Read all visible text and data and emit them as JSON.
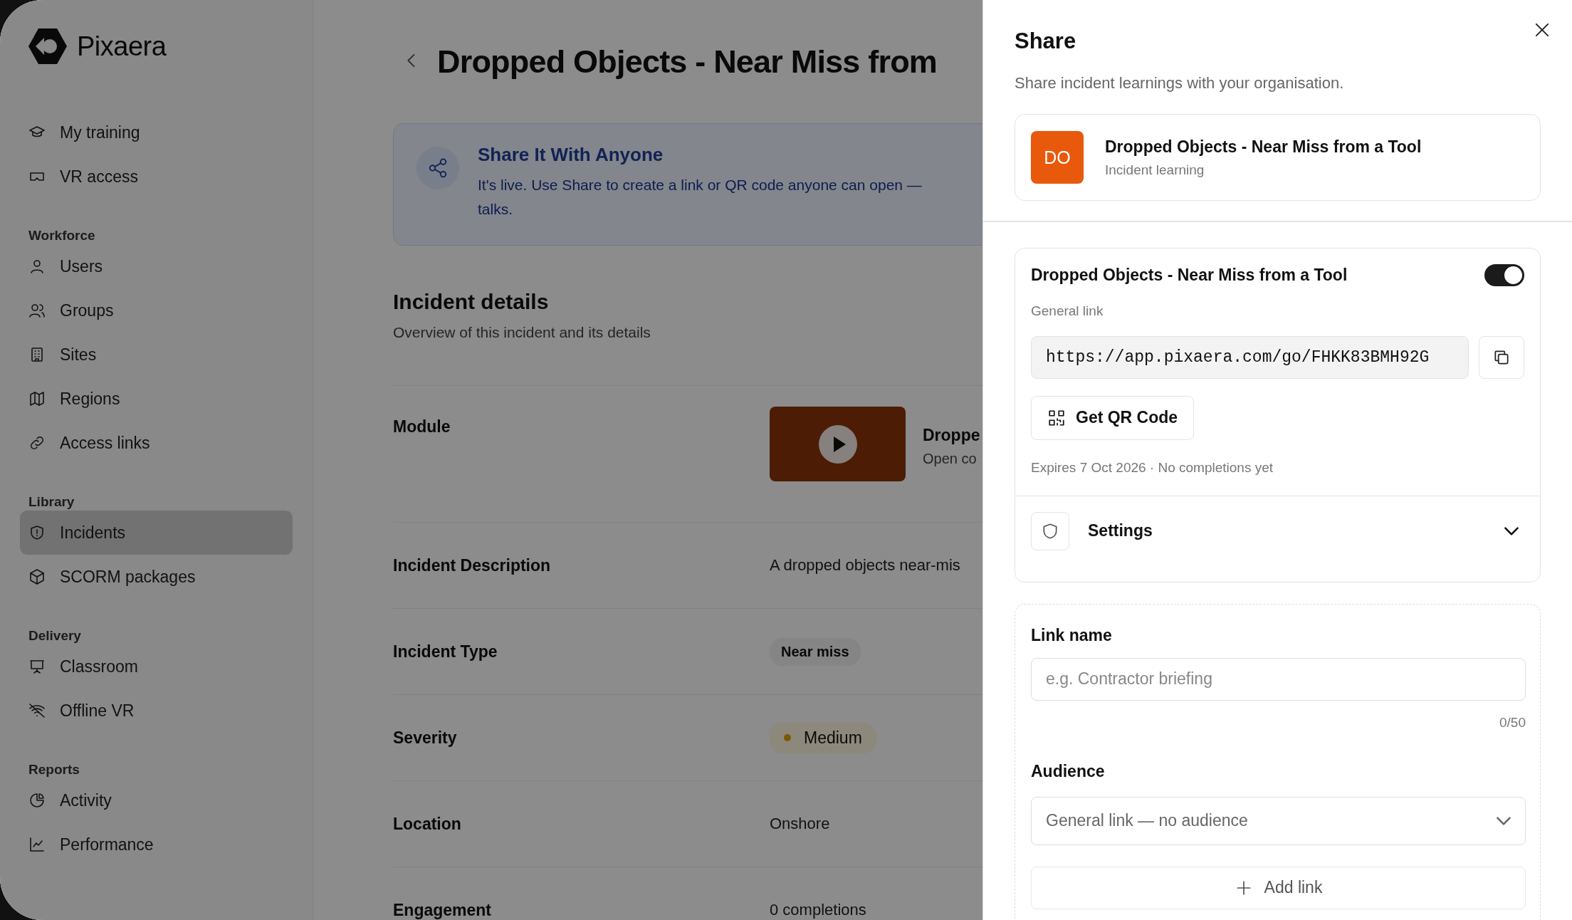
{
  "sidebar": {
    "logo": "Pixaera",
    "sections": [
      {
        "items": [
          {
            "label": "My training",
            "selected": false
          },
          {
            "label": "VR access",
            "selected": false
          }
        ]
      },
      {
        "heading": "Workforce",
        "items": [
          {
            "label": "Users",
            "selected": false
          },
          {
            "label": "Groups",
            "selected": false
          },
          {
            "label": "Sites",
            "selected": false
          },
          {
            "label": "Regions",
            "selected": false
          },
          {
            "label": "Access links",
            "selected": false
          }
        ]
      },
      {
        "heading": "Library",
        "items": [
          {
            "label": "Incidents",
            "selected": true
          },
          {
            "label": "SCORM packages",
            "selected": false
          }
        ]
      },
      {
        "heading": "Delivery",
        "items": [
          {
            "label": "Classroom",
            "selected": false
          },
          {
            "label": "Offline VR",
            "selected": false
          }
        ]
      },
      {
        "heading": "Reports",
        "items": [
          {
            "label": "Activity",
            "selected": false
          },
          {
            "label": "Performance",
            "selected": false
          }
        ]
      }
    ]
  },
  "page": {
    "title": "Dropped Objects - Near Miss from",
    "banner": {
      "title": "Share It With Anyone",
      "lines": [
        "It's live. Use Share to create a link or QR code anyone can open —",
        "talks."
      ]
    },
    "section": {
      "title": "Incident details",
      "subtitle": "Overview of this incident and its details"
    },
    "rows": [
      {
        "kind": "module",
        "label": "Module",
        "title": "Droppe",
        "subtitle": "Open co"
      },
      {
        "kind": "text",
        "label": "Incident Description",
        "value": "A dropped objects near-mis"
      },
      {
        "kind": "tag",
        "label": "Incident Type",
        "value": "Near miss"
      },
      {
        "kind": "severity",
        "label": "Severity",
        "value": "Medium"
      },
      {
        "kind": "text",
        "label": "Location",
        "value": "Onshore"
      },
      {
        "kind": "text",
        "label": "Engagement",
        "value": "0 completions"
      }
    ]
  },
  "share_panel": {
    "title": "Share",
    "subtitle": "Share incident learnings with your organisation.",
    "incident": {
      "initials": "DO",
      "title": "Dropped Objects - Near Miss from a Tool",
      "subtitle": "Incident learning"
    },
    "link": {
      "title": "Dropped Objects - Near Miss from a Tool",
      "on": true,
      "label": "General link",
      "url": "https://app.pixaera.com/go/FHKK83BMH92G",
      "qr_button": "Get QR Code",
      "meta": "Expires 7 Oct 2026 · No completions yet",
      "settings": {
        "label": "Settings",
        "expanded": false
      }
    },
    "new_link": {
      "name_label": "Link name",
      "name_placeholder": "e.g. Contractor briefing",
      "counter": "0/50",
      "audience_label": "Audience",
      "audience_value": "General link — no audience",
      "add_button": "Add link"
    }
  }
}
